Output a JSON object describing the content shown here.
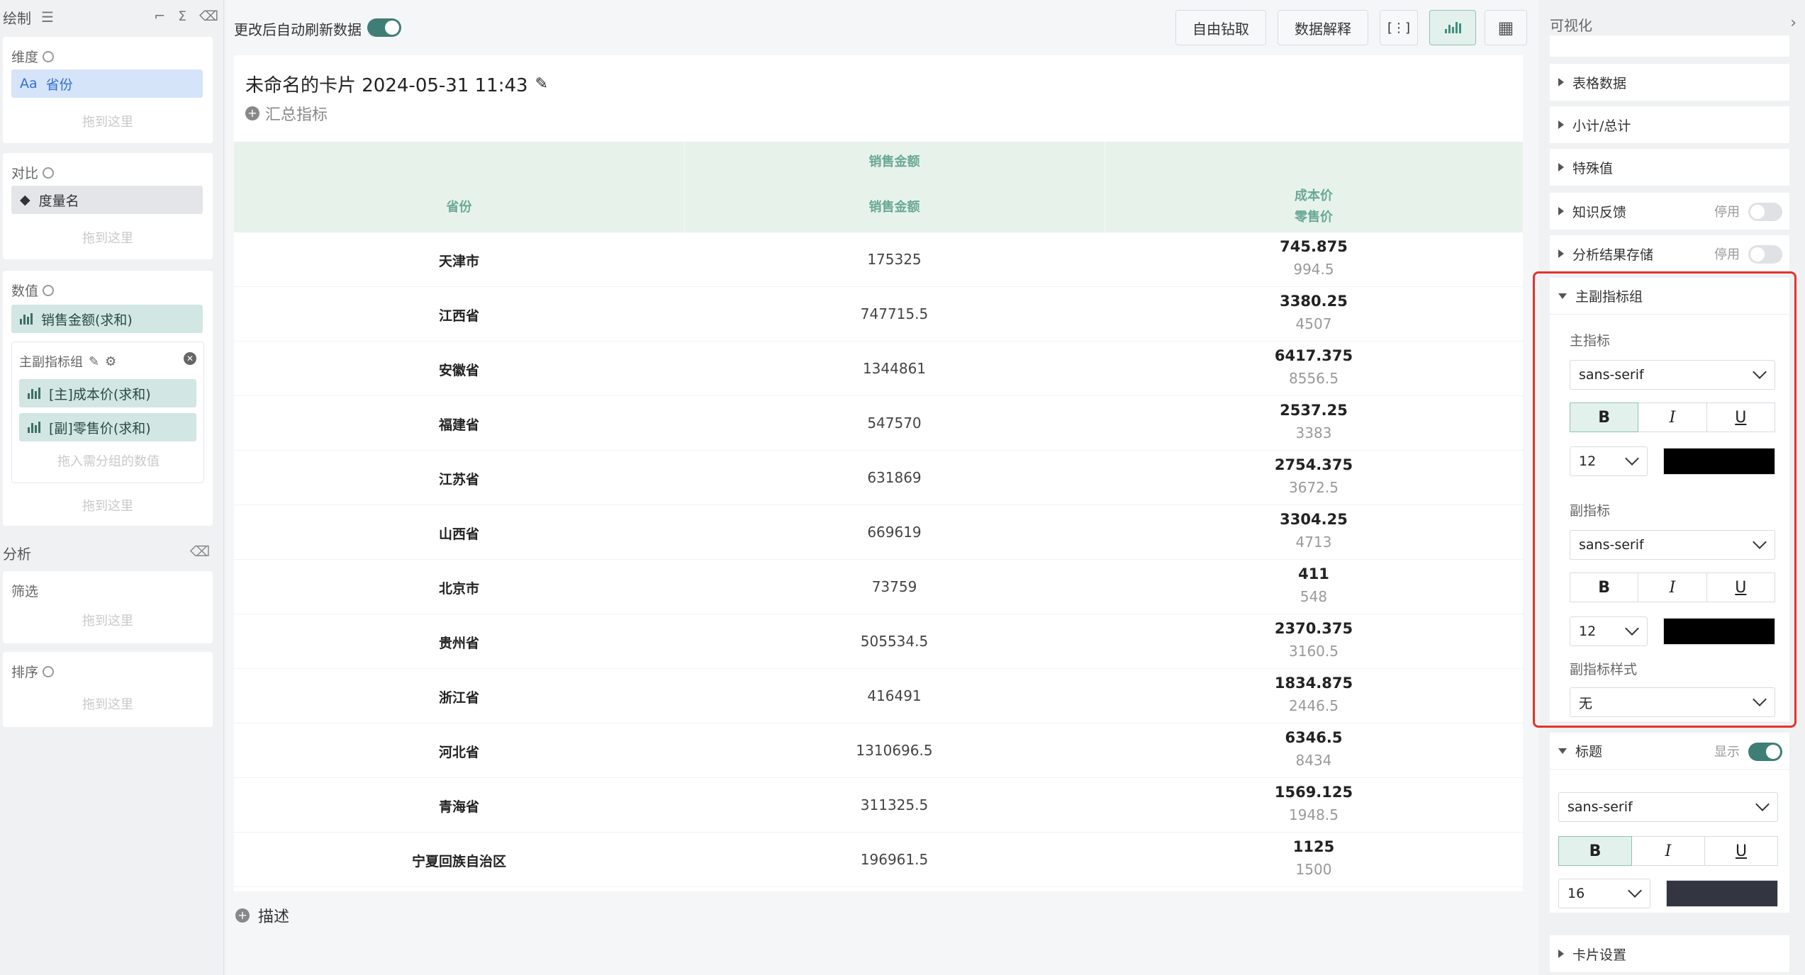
{
  "left": {
    "header": "绘制",
    "dimension": {
      "title": "维度",
      "field_prefix": "Aa",
      "field": "省份",
      "drop": "拖到这里"
    },
    "compare": {
      "title": "对比",
      "field": "度量名",
      "drop": "拖到这里"
    },
    "values": {
      "title": "数值",
      "field": "销售金额(求和)",
      "group_title": "主副指标组",
      "group_items": [
        "[主]成本价(求和)",
        "[副]零售价(求和)"
      ],
      "group_drop": "拖入需分组的数值",
      "drop": "拖到这里"
    },
    "analysis": {
      "title": "分析"
    },
    "filter": {
      "title": "筛选",
      "drop": "拖到这里"
    },
    "sort": {
      "title": "排序",
      "drop": "拖到这里"
    }
  },
  "toolbar": {
    "auto_refresh_label": "更改后自动刷新数据",
    "drill_button": "自由钻取",
    "explain_button": "数据解释"
  },
  "card": {
    "title": "未命名的卡片 2024-05-31 11:43",
    "summary_metric": "汇总指标",
    "description": "描述"
  },
  "table": {
    "group_header": "销售金额",
    "col_province": "省份",
    "col_sales": "销售金额",
    "col_cost": "成本价",
    "col_retail": "零售价",
    "rows": [
      {
        "province": "天津市",
        "sales": "175325",
        "cost": "745.875",
        "retail": "994.5"
      },
      {
        "province": "江西省",
        "sales": "747715.5",
        "cost": "3380.25",
        "retail": "4507"
      },
      {
        "province": "安徽省",
        "sales": "1344861",
        "cost": "6417.375",
        "retail": "8556.5"
      },
      {
        "province": "福建省",
        "sales": "547570",
        "cost": "2537.25",
        "retail": "3383"
      },
      {
        "province": "江苏省",
        "sales": "631869",
        "cost": "2754.375",
        "retail": "3672.5"
      },
      {
        "province": "山西省",
        "sales": "669619",
        "cost": "3304.25",
        "retail": "4713"
      },
      {
        "province": "北京市",
        "sales": "73759",
        "cost": "411",
        "retail": "548"
      },
      {
        "province": "贵州省",
        "sales": "505534.5",
        "cost": "2370.375",
        "retail": "3160.5"
      },
      {
        "province": "浙江省",
        "sales": "416491",
        "cost": "1834.875",
        "retail": "2446.5"
      },
      {
        "province": "河北省",
        "sales": "1310696.5",
        "cost": "6346.5",
        "retail": "8434"
      },
      {
        "province": "青海省",
        "sales": "311325.5",
        "cost": "1569.125",
        "retail": "1948.5"
      },
      {
        "province": "宁夏回族自治区",
        "sales": "196961.5",
        "cost": "1125",
        "retail": "1500"
      }
    ]
  },
  "right": {
    "header": "可视化",
    "items": {
      "table_data": "表格数据",
      "subtotal": "小计/总计",
      "special": "特殊值",
      "feedback": "知识反馈",
      "storage": "分析结果存储",
      "disabled": "停用",
      "metric_group": "主副指标组",
      "title": "标题",
      "show": "显示",
      "card_settings": "卡片设置"
    },
    "main_metric": {
      "label": "主指标",
      "font": "sans-serif",
      "size": "12",
      "color": "#000000"
    },
    "sub_metric": {
      "label": "副指标",
      "font": "sans-serif",
      "size": "12",
      "color": "#000000"
    },
    "sub_style": {
      "label": "副指标样式",
      "value": "无"
    },
    "title_style": {
      "font": "sans-serif",
      "size": "16",
      "color": "#333640"
    },
    "format_bold": "B",
    "format_italic": "I",
    "format_underline": "U"
  }
}
